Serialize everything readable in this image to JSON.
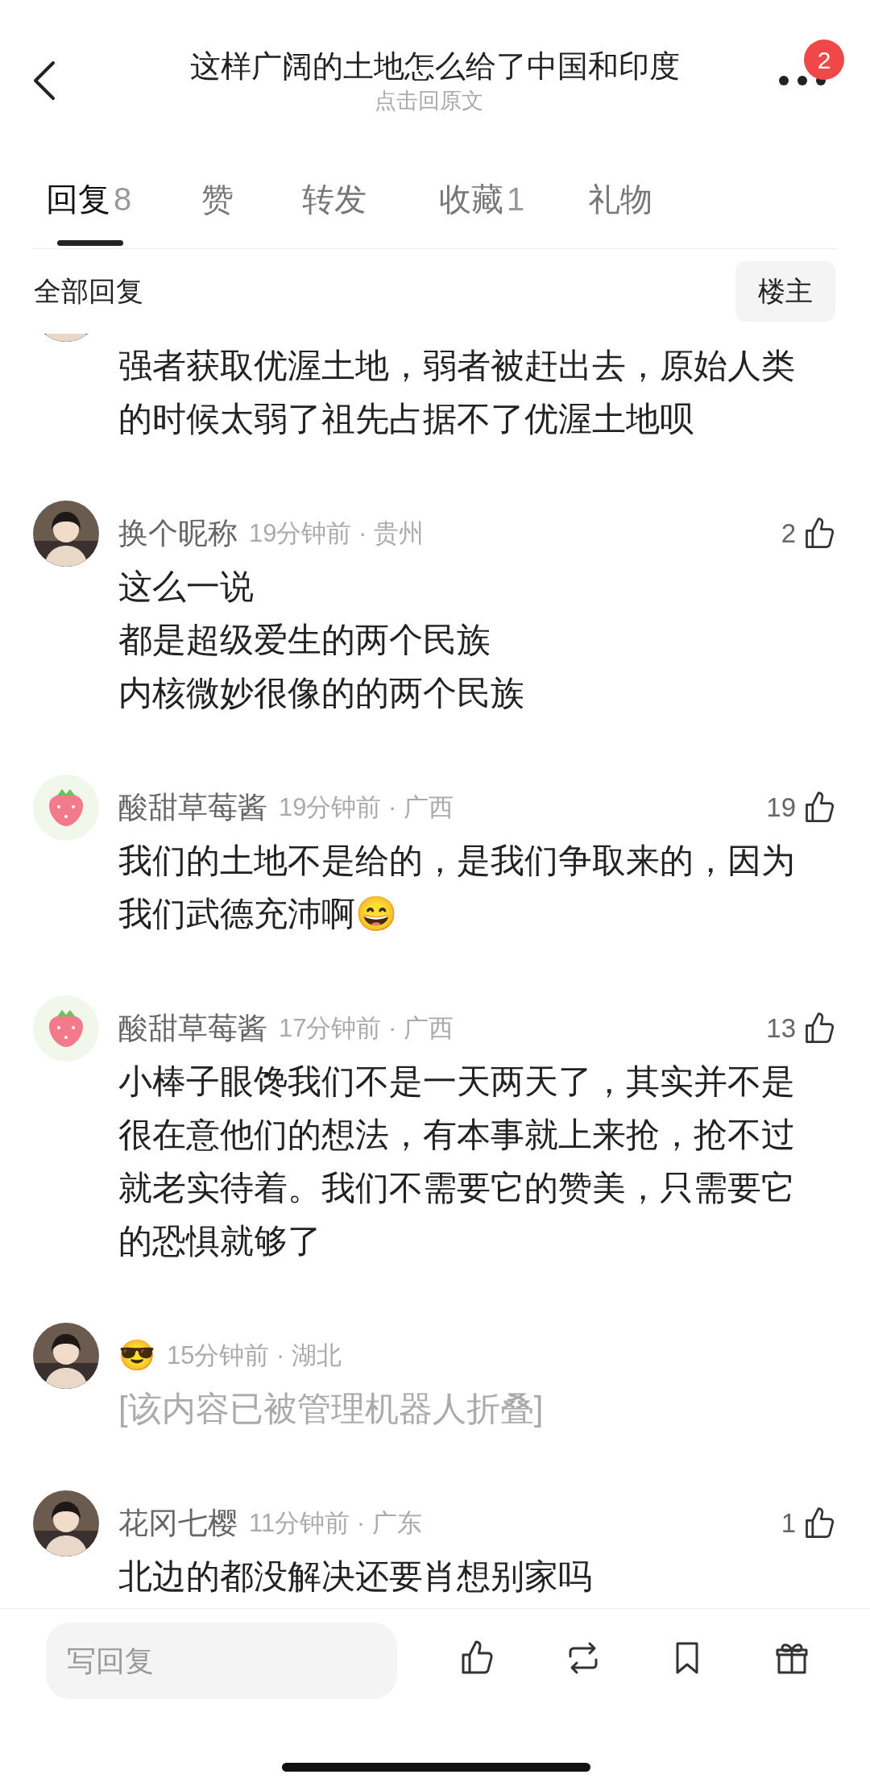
{
  "header": {
    "title": "这样广阔的土地怎么给了中国和印度",
    "subtitle": "点击回原文",
    "badge": "2"
  },
  "tabs": [
    {
      "label": "回复",
      "count": "8",
      "selected": true
    },
    {
      "label": "赞",
      "selected": false
    },
    {
      "label": "转发",
      "selected": false
    },
    {
      "label": "收藏",
      "count": "1",
      "selected": false
    },
    {
      "label": "礼物",
      "selected": false
    }
  ],
  "filter": {
    "label": "全部回复",
    "button": "楼主"
  },
  "comments": [
    {
      "kind": "partial",
      "paragraphs": [
        "强者获取优渥土地，弱者被赶出去，原始人类的时候太弱了祖先占据不了优渥土地呗"
      ],
      "folded": false
    },
    {
      "name": "换个昵称",
      "meta": "19分钟前 · 贵州",
      "likes": "2",
      "paragraphs": [
        "这么一说",
        "都是超级爱生的两个民族",
        "内核微妙很像的的两个民族"
      ],
      "folded": false
    },
    {
      "kind": "strawberry",
      "name": "酸甜草莓酱",
      "meta": "19分钟前 · 广西",
      "likes": "19",
      "paragraphs": [
        "我们的土地不是给的，是我们争取来的，因为我们武德充沛啊😄"
      ],
      "folded": false
    },
    {
      "kind": "strawberry",
      "name": "酸甜草莓酱",
      "meta": "17分钟前 · 广西",
      "likes": "13",
      "paragraphs": [
        "小棒子眼馋我们不是一天两天了，其实并不是很在意他们的想法，有本事就上来抢，抢不过就老实待着。我们不需要它的赞美，只需要它的恐惧就够了"
      ],
      "folded": false
    },
    {
      "name": "😎",
      "meta": "15分钟前 · 湖北",
      "paragraphs": [
        "[该内容已被管理机器人折叠]"
      ],
      "folded": true
    },
    {
      "name": "花冈七樱",
      "meta": "11分钟前 · 广东",
      "likes": "1",
      "paragraphs": [
        "北边的都没解决还要肖想别家吗"
      ],
      "folded": false
    }
  ],
  "reply_bar": {
    "placeholder": "写回复"
  }
}
